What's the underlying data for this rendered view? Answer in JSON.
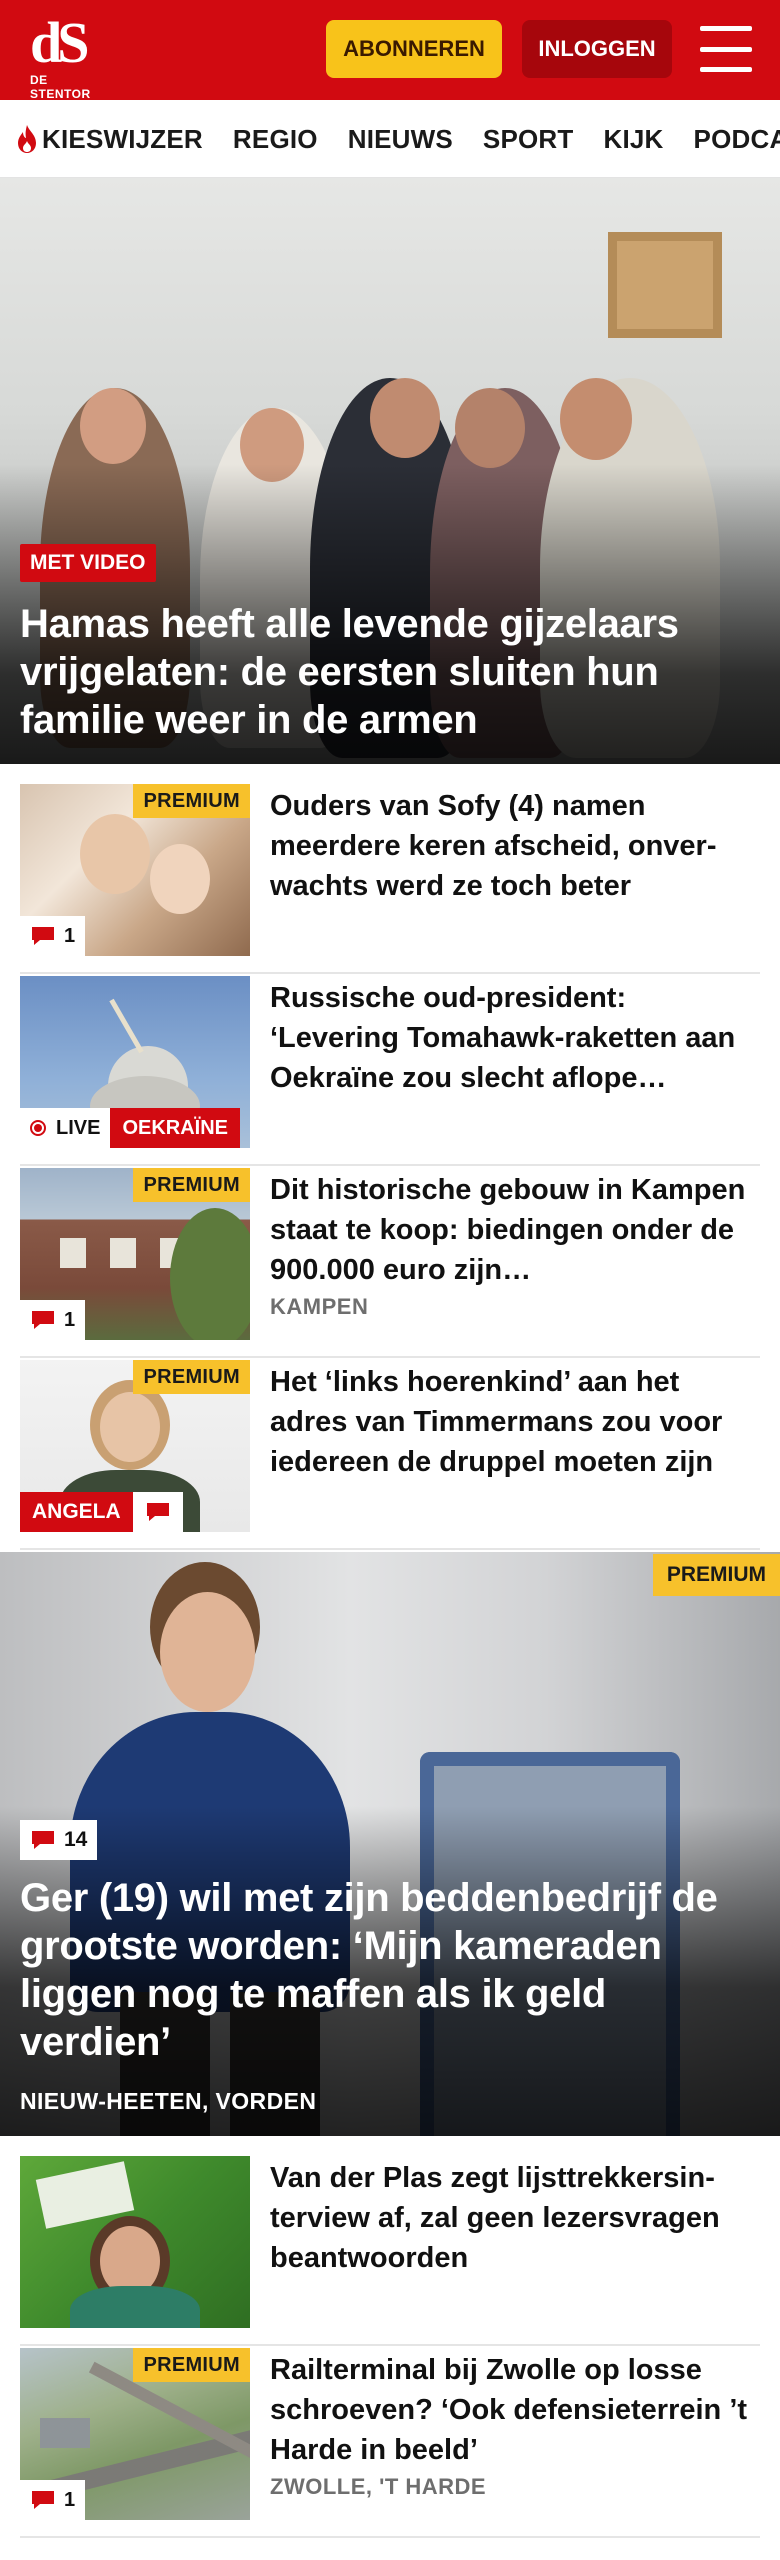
{
  "header": {
    "logo_mark": "dS",
    "logo_sub": "DE STENTOR",
    "subscribe_label": "ABONNEREN",
    "login_label": "INLOGGEN",
    "brand_color": "#d10a11",
    "subscribe_color": "#f8c31a"
  },
  "nav": {
    "items": [
      {
        "label": "KIESWIJZER",
        "icon": "flame-icon"
      },
      {
        "label": "REGIO"
      },
      {
        "label": "NIEUWS"
      },
      {
        "label": "SPORT"
      },
      {
        "label": "KIJK"
      },
      {
        "label": "PODCAS"
      }
    ]
  },
  "hero": {
    "badge": "MET VIDEO",
    "title": "Hamas heeft alle levende gijzelaars vrijgelaten: de eersten sluiten hun familie weer in de armen"
  },
  "articles": [
    {
      "title": "Ouders van Sofy (4) namen meerdere keren afscheid, onver-wachts werd ze toch beter",
      "premium": "PREMIUM",
      "comments": "1"
    },
    {
      "title": "Russische oud-president: ‘Levering Tomahawk-raketten aan Oekraïne zou slecht aflope…",
      "live": "LIVE",
      "tag": "OEKRAÏNE"
    },
    {
      "title": "Dit historische gebouw in Kampen staat te koop: biedingen onder de 900.000 euro zijn…",
      "premium": "PREMIUM",
      "comments": "1",
      "location": "KAMPEN"
    },
    {
      "title": "Het ‘links hoerenkind’ aan het adres van Timmermans zou voor iedereen de druppel moeten zijn",
      "premium": "PREMIUM",
      "author_tag": "ANGELA"
    }
  ],
  "feature": {
    "premium": "PREMIUM",
    "comments": "14",
    "title": "Ger (19) wil met zijn beddenbedrijf de grootste worden: ‘Mijn kameraden liggen nog te maffen als ik geld verdien’",
    "location": "NIEUW-HEETEN, VORDEN"
  },
  "articles2": [
    {
      "title": "Van der Plas zegt lijsttrekkersin-terview af, zal geen lezersvragen beantwoorden"
    },
    {
      "title": "Railterminal bij Zwolle op losse schroeven? ‘Ook defensieterrein ’t Harde in beeld’",
      "premium": "PREMIUM",
      "comments": "1",
      "location": "ZWOLLE, 'T HARDE"
    }
  ]
}
